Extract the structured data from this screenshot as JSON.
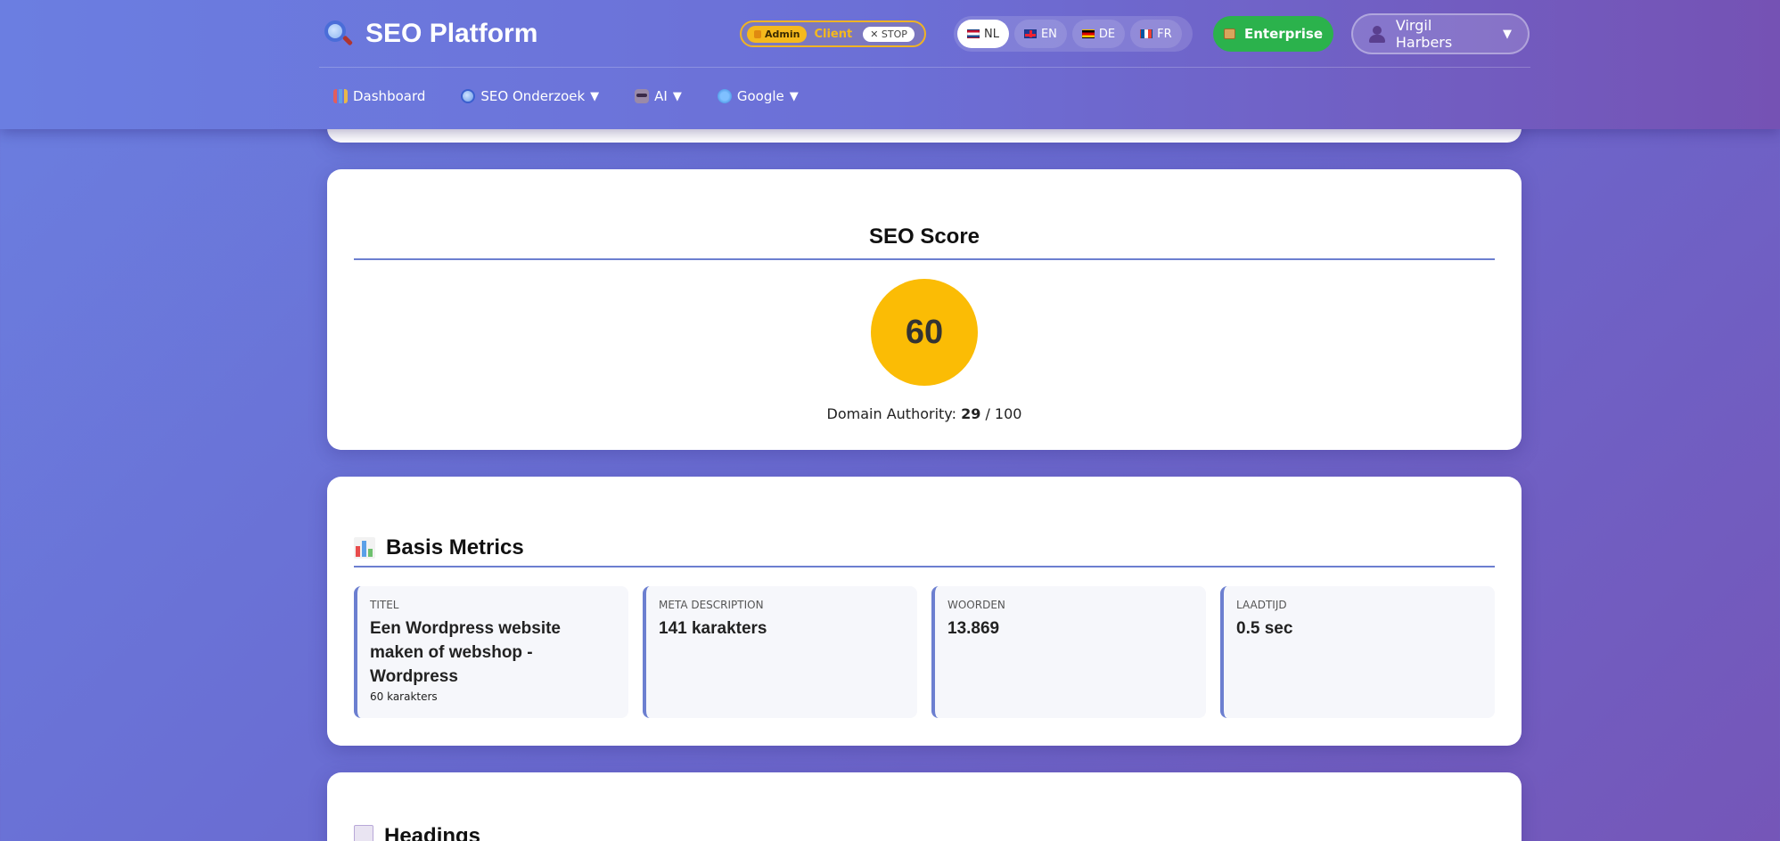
{
  "header": {
    "brand_title": "SEO Platform",
    "admin_switch": {
      "admin_label": "Admin",
      "client_label": "Client",
      "stop_label": "✕ STOP"
    },
    "languages": [
      {
        "code": "NL",
        "active": true
      },
      {
        "code": "EN",
        "active": false
      },
      {
        "code": "DE",
        "active": false
      },
      {
        "code": "FR",
        "active": false
      }
    ],
    "plan_label": "Enterprise",
    "user_name": "Virgil Harbers",
    "user_chevron": "▼",
    "nav": [
      {
        "label": "Dashboard",
        "icon": "bar-chart-icon"
      },
      {
        "label": "SEO Onderzoek",
        "icon": "magnifier-icon",
        "caret": "▼"
      },
      {
        "label": "AI",
        "icon": "robot-icon",
        "caret": "▼"
      },
      {
        "label": "Google",
        "icon": "globe-icon",
        "caret": "▼"
      }
    ]
  },
  "score_card": {
    "title": "SEO Score",
    "score": "60",
    "authority_label": "Domain Authority:",
    "authority_value": "29",
    "authority_max": "/ 100",
    "score_color": "#fbbc05"
  },
  "metrics_card": {
    "title": "Basis Metrics",
    "items": [
      {
        "label": "Titel",
        "value": "Een Wordpress website maken of webshop - Wordpress",
        "sub": "60 karakters"
      },
      {
        "label": "Meta description",
        "value": "141 karakters",
        "sub": ""
      },
      {
        "label": "Woorden",
        "value": "13.869",
        "sub": ""
      },
      {
        "label": "Laadtijd",
        "value": "0.5 sec",
        "sub": ""
      }
    ]
  },
  "headings_card": {
    "title": "Headings"
  },
  "colors": {
    "accent": "#6c7fd0",
    "plan_green": "#2bb24c",
    "admin_amber": "#f5b91c"
  }
}
